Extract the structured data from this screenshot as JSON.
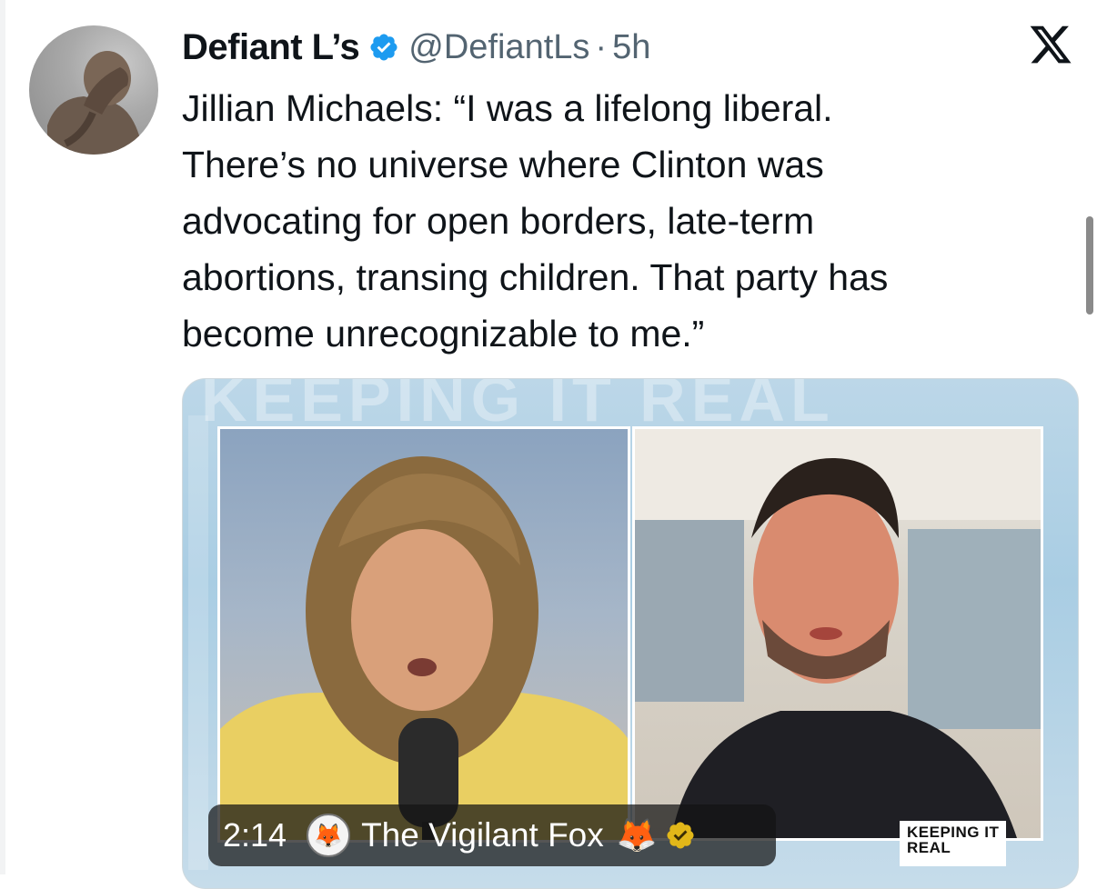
{
  "tweet": {
    "author_name": "Defiant L’s",
    "handle": "@DefiantLs",
    "separator": "·",
    "time": "5h",
    "text": "Jillian Michaels: “I was a lifelong liberal.\nThere’s no universe where Clinton was\nadvocating for open borders, late-term\nabortions, transing children. That party has\nbecome unrecognizable to me.”"
  },
  "media": {
    "duration": "2:14",
    "attribution": "The Vigilant Fox",
    "attribution_emoji": "🦊",
    "background_word": "KEEPING IT REAL",
    "logo_line1": "KEEPING IT",
    "logo_line2": "REAL"
  },
  "icons": {
    "verified": "verified-check-badge",
    "x_logo": "x-logo",
    "gold_verified": "gold-verified-badge"
  },
  "colors": {
    "verified_blue": "#1d9bf0",
    "secondary_text": "#536471",
    "gold_badge": "#e2b719"
  }
}
